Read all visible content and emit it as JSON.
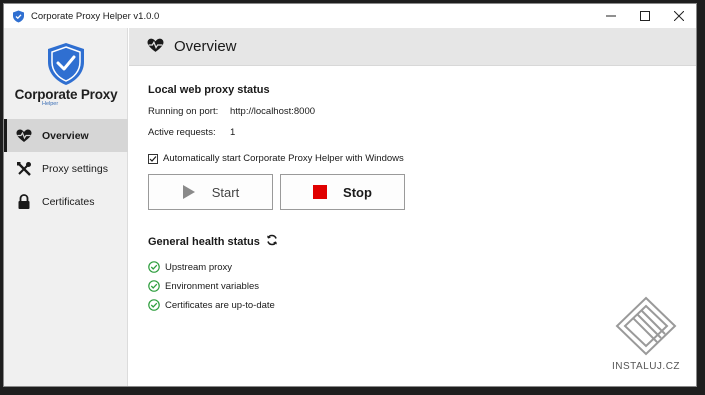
{
  "window": {
    "title": "Corporate Proxy Helper v1.0.0"
  },
  "logo": {
    "name": "Corporate Proxy",
    "sub": "Helper"
  },
  "sidebar": {
    "items": [
      {
        "label": "Overview",
        "icon": "heartbeat-icon",
        "active": true
      },
      {
        "label": "Proxy settings",
        "icon": "tools-icon",
        "active": false
      },
      {
        "label": "Certificates",
        "icon": "lock-icon",
        "active": false
      }
    ]
  },
  "header": {
    "title": "Overview"
  },
  "proxy": {
    "section_title": "Local web proxy status",
    "port_label": "Running on port:",
    "port_value": "http://localhost:8000",
    "requests_label": "Active requests:",
    "requests_value": "1",
    "autostart_label": "Automatically start Corporate Proxy Helper with Windows",
    "autostart_checked": true
  },
  "buttons": {
    "start_label": "Start",
    "stop_label": "Stop"
  },
  "health": {
    "title": "General health status",
    "items": [
      "Upstream proxy",
      "Environment variables",
      "Certificates are up-to-date"
    ]
  },
  "watermark": {
    "text": "INSTALUJ.CZ"
  },
  "colors": {
    "accent": "#2f6fd1",
    "stop": "#e00000",
    "ok": "#2e9e3e",
    "sidebar": "#f0f0f0"
  }
}
